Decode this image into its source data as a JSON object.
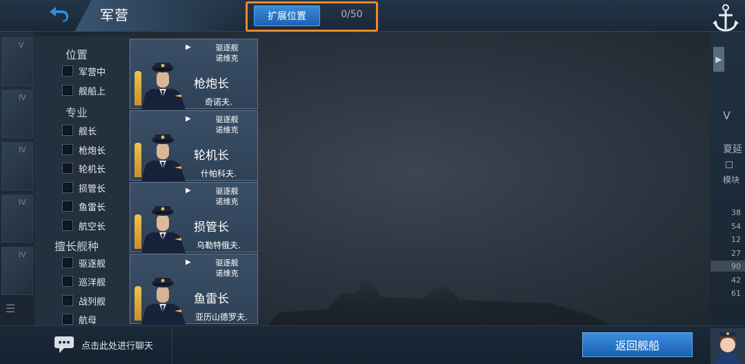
{
  "header": {
    "title": "军营",
    "expand_button": "扩展位置",
    "capacity": "0/50"
  },
  "filters": {
    "location_heading": "位置",
    "location_items": [
      "军营中",
      "舰船上"
    ],
    "specialty_heading": "专业",
    "specialty_items": [
      "舰长",
      "枪炮长",
      "轮机长",
      "损管长",
      "鱼雷长",
      "航空长"
    ],
    "shiptype_heading": "擅长舰种",
    "shiptype_items": [
      "驱逐舰",
      "巡洋舰",
      "战列舰",
      "航母"
    ]
  },
  "crew": [
    {
      "ship_type": "驱逐舰",
      "ship_name": "诺维克",
      "role": "枪炮长",
      "name": "奇诺夫."
    },
    {
      "ship_type": "驱逐舰",
      "ship_name": "诺维克",
      "role": "轮机长",
      "name": "什帕科夫."
    },
    {
      "ship_type": "驱逐舰",
      "ship_name": "诺维克",
      "role": "损管长",
      "name": "乌勒特俄夫."
    },
    {
      "ship_type": "驱逐舰",
      "ship_name": "诺维克",
      "role": "鱼雷长",
      "name": "亚历山德罗夫."
    }
  ],
  "right_panel": {
    "label_top": "V",
    "label_name": "夏延",
    "label_module": "模块",
    "stats": [
      "38",
      "54",
      "12",
      "27",
      "90",
      "42",
      "61"
    ]
  },
  "left_strip": {
    "tiers": [
      "V",
      "IV",
      "IV",
      "IV",
      "IV"
    ]
  },
  "bottom": {
    "chat_label": "点击此处进行聊天",
    "return_button": "返回舰船"
  },
  "colors": {
    "accent_blue": "#2f8de0",
    "highlight_orange": "#f08a2a",
    "rank_gold": "#f2c14c"
  }
}
